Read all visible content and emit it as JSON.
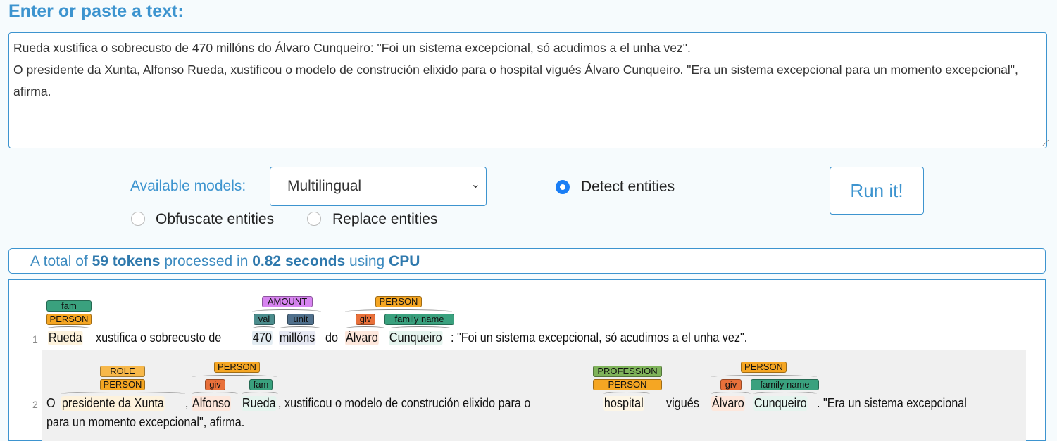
{
  "header": {
    "title": "Enter or paste a text:"
  },
  "input": {
    "value": "Rueda xustifica o sobrecusto de 470 millóns do Álvaro Cunqueiro: \"Foi un sistema excepcional, só acudimos a el unha vez\".\nO presidente da Xunta, Alfonso Rueda, xustificou o modelo de construción elixido para o hospital vigués Álvaro Cunqueiro. \"Era un sistema excepcional para un momento excepcional\", afirma."
  },
  "controls": {
    "models_label": "Available models:",
    "model_selected": "Multilingual",
    "modes": [
      {
        "label": "Detect entities",
        "checked": true
      },
      {
        "label": "Obfuscate entities",
        "checked": false
      },
      {
        "label": "Replace entities",
        "checked": false
      }
    ],
    "run_label": "Run it!"
  },
  "summary": {
    "prefix": "A total of",
    "tokens": "59 tokens",
    "mid": "processed in",
    "time": "0.82 seconds",
    "using": "using",
    "device": "CPU"
  },
  "colors": {
    "accent": "#3d94cf",
    "PERSON": "#f5a623",
    "fam": "#3aa17e",
    "giv": "#e8703a",
    "AMOUNT": "#d784f0",
    "val": "#4b8c8c",
    "unit": "#50708c",
    "ROLE": "#f7b84a",
    "PROFESSION": "#7fb35a"
  },
  "lines": [
    {
      "number": "1",
      "segments": [
        {
          "text": "Rueda",
          "tint": "#fdf2dc"
        },
        {
          "text": "xustifica o sobrecusto de"
        },
        {
          "text": "470",
          "tint": "#e3ecf2"
        },
        {
          "text": "millóns",
          "tint": "#e6e8f2"
        },
        {
          "text": "do"
        },
        {
          "text": "Álvaro",
          "tint": "#fde7dc"
        },
        {
          "text": "Cunqueiro",
          "tint": "#e5f4ee"
        },
        {
          "text": ": \"Foi un sistema excepcional, só acudimos a el unha vez\"."
        }
      ],
      "labels": [
        {
          "text": "fam",
          "type": "fam"
        },
        {
          "text": "PERSON",
          "type": "PERSON"
        },
        {
          "text": "AMOUNT",
          "type": "AMOUNT"
        },
        {
          "text": "val",
          "type": "val"
        },
        {
          "text": "unit",
          "type": "unit"
        },
        {
          "text": "PERSON",
          "type": "PERSON"
        },
        {
          "text": "giv",
          "type": "giv"
        },
        {
          "text": "family name",
          "type": "fam"
        }
      ]
    },
    {
      "number": "2",
      "segments": [
        {
          "text": "O"
        },
        {
          "text": "presidente da Xunta",
          "tint": "#fdf2dc"
        },
        {
          "text": ","
        },
        {
          "text": "Alfonso",
          "tint": "#fde7dc"
        },
        {
          "text": "Rueda",
          "tint": "#e5f4ee"
        },
        {
          "text": ", xustificou o modelo de construción elixido para o"
        },
        {
          "text": "hospital",
          "tint": "#fdf6e6"
        },
        {
          "text": "vigués"
        },
        {
          "text": "Álvaro",
          "tint": "#fde7dc"
        },
        {
          "text": "Cunqueiro",
          "tint": "#e5f4ee"
        },
        {
          "text": ". \"Era un sistema excepcional"
        },
        {
          "text": "para un momento excepcional\", afirma."
        }
      ],
      "labels": [
        {
          "text": "ROLE",
          "type": "ROLE"
        },
        {
          "text": "PERSON",
          "type": "PERSON"
        },
        {
          "text": "PERSON",
          "type": "PERSON"
        },
        {
          "text": "giv",
          "type": "giv"
        },
        {
          "text": "fam",
          "type": "fam"
        },
        {
          "text": "PROFESSION",
          "type": "PROFESSION"
        },
        {
          "text": "PERSON",
          "type": "PERSON"
        },
        {
          "text": "PERSON",
          "type": "PERSON"
        },
        {
          "text": "giv",
          "type": "giv"
        },
        {
          "text": "family name",
          "type": "fam"
        }
      ]
    }
  ]
}
